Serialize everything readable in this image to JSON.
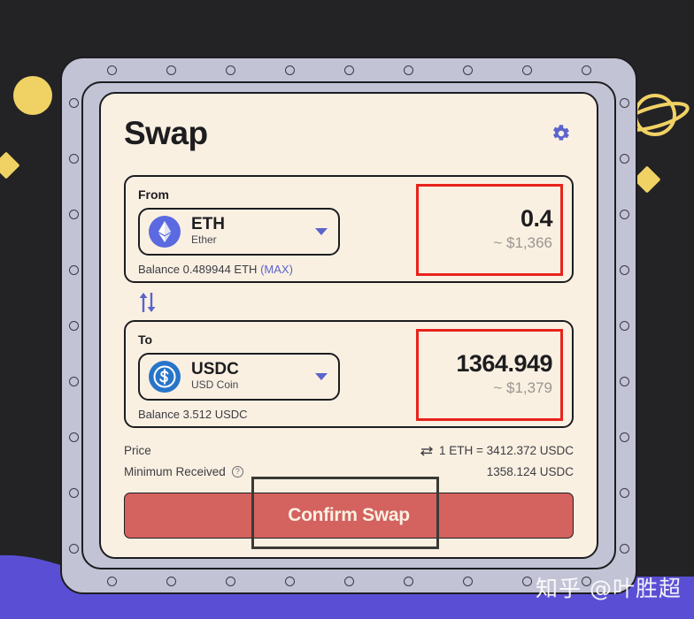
{
  "app": {
    "title": "Swap",
    "settings_icon": "gear-icon"
  },
  "from": {
    "label": "From",
    "token_symbol": "ETH",
    "token_name": "Ether",
    "token_icon": "ethereum-icon",
    "caret_icon": "chevron-down-icon",
    "balance_text": "Balance 0.489944 ETH",
    "max_label": "(MAX)",
    "amount": "0.4",
    "amount_usd": "~ $1,366",
    "highlight_color": "#e8231c"
  },
  "switch": {
    "icon": "swap-vertical-arrows-icon"
  },
  "to": {
    "label": "To",
    "token_symbol": "USDC",
    "token_name": "USD Coin",
    "token_icon": "usdc-icon",
    "caret_icon": "chevron-down-icon",
    "balance_text": "Balance 3.512 USDC",
    "amount": "1364.949",
    "amount_usd": "~ $1,379",
    "highlight_color": "#e8231c"
  },
  "details": {
    "price_label": "Price",
    "price_swap_icon": "swap-horizontal-icon",
    "price_value": "1 ETH = 3412.372 USDC",
    "minimum_label": "Minimum Received",
    "minimum_info_icon": "question-mark-icon",
    "minimum_value": "1358.124 USDC"
  },
  "action": {
    "confirm_label": "Confirm Swap",
    "confirm_color": "#d4625f"
  },
  "decor": {
    "circle_icon": "yellow-circle-decoration",
    "diamond_left_icon": "yellow-diamond-decoration",
    "diamond_right_icon": "yellow-diamond-decoration",
    "planet_icon": "saturn-planet-decoration",
    "wave_icon": "purple-wave-decoration",
    "yellow": "#f0d264",
    "purple": "#5a4fd4",
    "background": "#232326",
    "frame": "#c3c3d6",
    "card": "#faf0e2"
  },
  "watermark": {
    "text": "知乎 @叶胜超"
  }
}
